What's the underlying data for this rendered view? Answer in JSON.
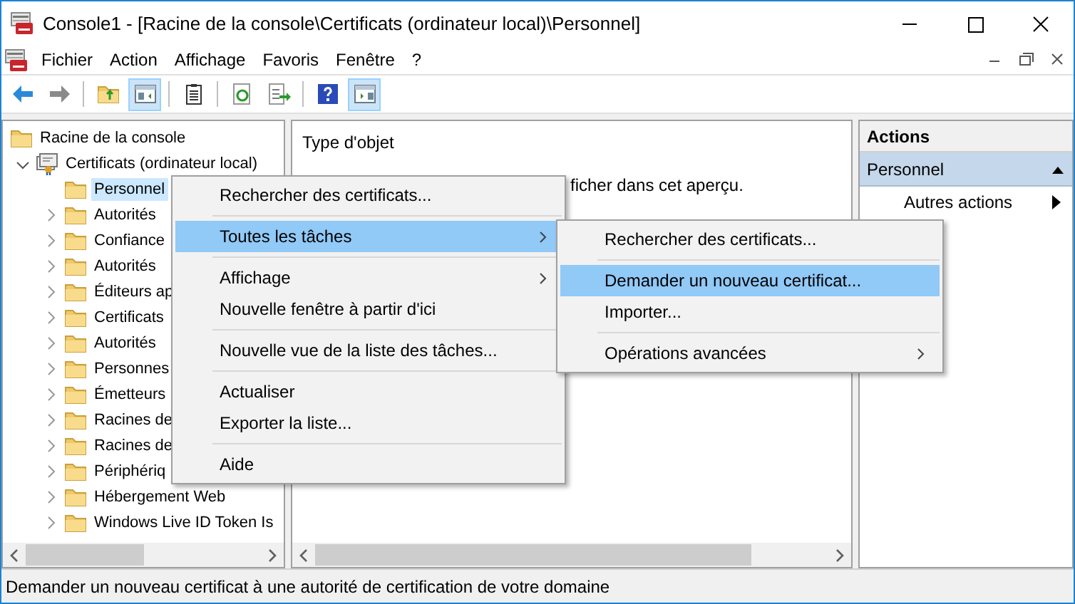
{
  "window": {
    "title": "Console1 - [Racine de la console\\Certificats (ordinateur local)\\Personnel]"
  },
  "menu_bar": [
    "Fichier",
    "Action",
    "Affichage",
    "Favoris",
    "Fenêtre",
    "?"
  ],
  "toolbar": [
    {
      "kind": "back",
      "pressed": false
    },
    {
      "kind": "forward",
      "pressed": false
    },
    {
      "kind": "sep"
    },
    {
      "kind": "up",
      "pressed": false
    },
    {
      "kind": "tree",
      "pressed": true
    },
    {
      "kind": "sep"
    },
    {
      "kind": "properties",
      "pressed": false
    },
    {
      "kind": "sep"
    },
    {
      "kind": "refresh",
      "pressed": false
    },
    {
      "kind": "export",
      "pressed": false
    },
    {
      "kind": "sep"
    },
    {
      "kind": "help",
      "pressed": false
    },
    {
      "kind": "actionpane",
      "pressed": true
    }
  ],
  "tree": {
    "label": "Racine de la console",
    "children": [
      {
        "label": "Certificats (ordinateur local)",
        "expanded": true,
        "children": [
          {
            "label": "Personnel",
            "selected": true
          },
          {
            "label": "Autorités",
            "selected": false
          },
          {
            "label": "Confiance",
            "selected": false
          },
          {
            "label": "Autorités",
            "selected": false
          },
          {
            "label": "Éditeurs ap",
            "selected": false
          },
          {
            "label": "Certificats",
            "selected": false
          },
          {
            "label": "Autorités",
            "selected": false
          },
          {
            "label": "Personnes",
            "selected": false
          },
          {
            "label": "Émetteurs",
            "selected": false
          },
          {
            "label": "Racines de",
            "selected": false
          },
          {
            "label": "Racines de",
            "selected": false
          },
          {
            "label": "Périphériq",
            "selected": false
          },
          {
            "label": "Hébergement Web",
            "selected": false
          },
          {
            "label": "Windows Live ID Token Is",
            "selected": false
          }
        ]
      }
    ]
  },
  "center": {
    "column": "Type d'objet",
    "message": "ficher dans cet aperçu."
  },
  "actions": {
    "title": "Actions",
    "section": {
      "label": "Personnel",
      "expanded": true
    },
    "items": [
      {
        "label": "Autres actions"
      }
    ]
  },
  "context_menu": [
    {
      "kind": "item",
      "label": "Rechercher des certificats...",
      "selected": false,
      "submenu": false
    },
    {
      "kind": "separator"
    },
    {
      "kind": "item",
      "label": "Toutes les tâches",
      "selected": true,
      "submenu": true
    },
    {
      "kind": "separator"
    },
    {
      "kind": "item",
      "label": "Affichage",
      "selected": false,
      "submenu": true
    },
    {
      "kind": "item",
      "label": "Nouvelle fenêtre à partir d'ici",
      "selected": false,
      "submenu": false
    },
    {
      "kind": "separator"
    },
    {
      "kind": "item",
      "label": "Nouvelle vue de la liste des tâches...",
      "selected": false,
      "submenu": false
    },
    {
      "kind": "separator"
    },
    {
      "kind": "item",
      "label": "Actualiser",
      "selected": false,
      "submenu": false
    },
    {
      "kind": "item",
      "label": "Exporter la liste...",
      "selected": false,
      "submenu": false
    },
    {
      "kind": "separator"
    },
    {
      "kind": "item",
      "label": "Aide",
      "selected": false,
      "submenu": false
    }
  ],
  "submenu": [
    {
      "kind": "item",
      "label": "Rechercher des certificats...",
      "selected": false,
      "submenu": false
    },
    {
      "kind": "separator"
    },
    {
      "kind": "item",
      "label": "Demander un nouveau certificat...",
      "selected": true,
      "submenu": false
    },
    {
      "kind": "item",
      "label": "Importer...",
      "selected": false,
      "submenu": false
    },
    {
      "kind": "separator"
    },
    {
      "kind": "item",
      "label": "Opérations avancées",
      "selected": false,
      "submenu": true
    }
  ],
  "status_bar": "Demander un nouveau certificat à une autorité de certification de votre domaine"
}
